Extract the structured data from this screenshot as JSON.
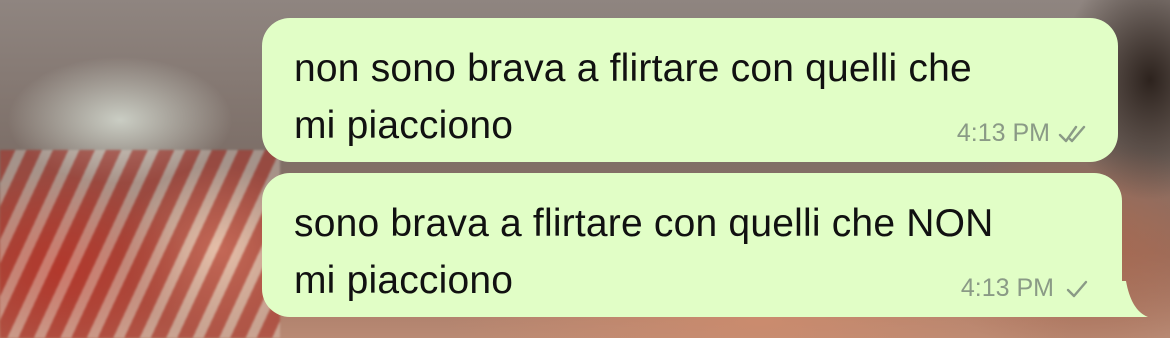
{
  "messages": [
    {
      "text": "non sono brava a flirtare con quelli che\nmi piacciono",
      "time": "4:13 PM",
      "status": "double-check-icon"
    },
    {
      "text": "sono brava a flirtare con quelli che NON\nmi piacciono",
      "time": "4:13 PM",
      "status": "single-check-icon"
    }
  ],
  "colors": {
    "bubble": "#e1fec6",
    "meta": "#8a9a86"
  }
}
